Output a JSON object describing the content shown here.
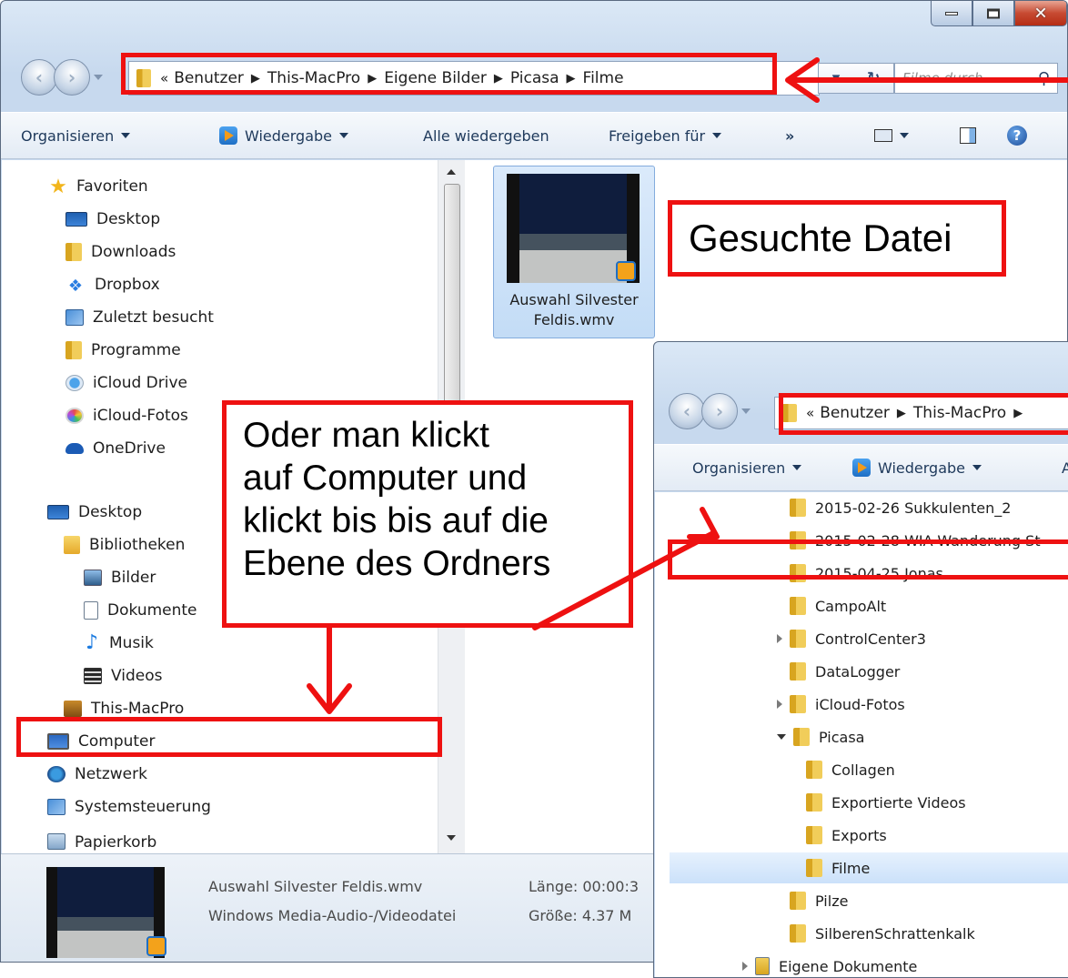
{
  "main_window": {
    "breadcrumb_prefix": "«",
    "breadcrumb": [
      "Benutzer",
      "This-MacPro",
      "Eigene Bilder",
      "Picasa",
      "Filme"
    ],
    "search_placeholder": "Filme durch...",
    "toolbar": {
      "organize": "Organisieren",
      "play": "Wiedergabe",
      "play_all": "Alle wiedergeben",
      "share": "Freigeben für",
      "more": "»"
    },
    "nav": {
      "favorites_header": "Favoriten",
      "favorites": [
        "Desktop",
        "Downloads",
        "Dropbox",
        "Zuletzt besucht",
        "Programme",
        "iCloud Drive",
        "iCloud-Fotos",
        "OneDrive"
      ],
      "desktop": "Desktop",
      "libraries": "Bibliotheken",
      "library_items": [
        "Bilder",
        "Dokumente",
        "Musik",
        "Videos"
      ],
      "user": "This-MacPro",
      "computer": "Computer",
      "network": "Netzwerk",
      "control_panel": "Systemsteuerung",
      "trash": "Papierkorb"
    },
    "file": {
      "name_line1": "Auswahl Silvester",
      "name_line2": "Feldis.wmv"
    },
    "details": {
      "filename": "Auswahl Silvester Feldis.wmv",
      "filetype": "Windows Media-Audio-/Videodatei",
      "length": "Länge: 00:00:3",
      "size": "Größe: 4.37 M"
    }
  },
  "second_window": {
    "breadcrumb_prefix": "«",
    "breadcrumb": [
      "Benutzer",
      "This-MacPro"
    ],
    "toolbar": {
      "organize": "Organisieren",
      "play": "Wiedergabe",
      "truncated": "A"
    },
    "tree": [
      {
        "label": "2015-02-26 Sukkulenten_2"
      },
      {
        "label": "2015-02-28 WIA-Wanderung St"
      },
      {
        "label": "2015-04-25 Jonas"
      },
      {
        "label": "CampoAlt"
      },
      {
        "label": "ControlCenter3"
      },
      {
        "label": "DataLogger"
      },
      {
        "label": "iCloud-Fotos"
      },
      {
        "label": "Picasa"
      },
      {
        "label": "Collagen"
      },
      {
        "label": "Exportierte Videos"
      },
      {
        "label": "Exports"
      },
      {
        "label": "Filme"
      },
      {
        "label": "Pilze"
      },
      {
        "label": "SilberenSchrattenkalk"
      },
      {
        "label": "Eigene Dokumente"
      }
    ]
  },
  "annotations": {
    "search_file": "Gesuchte Datei",
    "instruction": [
      "Oder man klickt",
      "auf Computer und",
      "klickt bis bis auf die",
      "Ebene des Ordners"
    ]
  },
  "colors": {
    "annotation_red": "#ee1111",
    "selection_blue": "#cbe1fa"
  }
}
